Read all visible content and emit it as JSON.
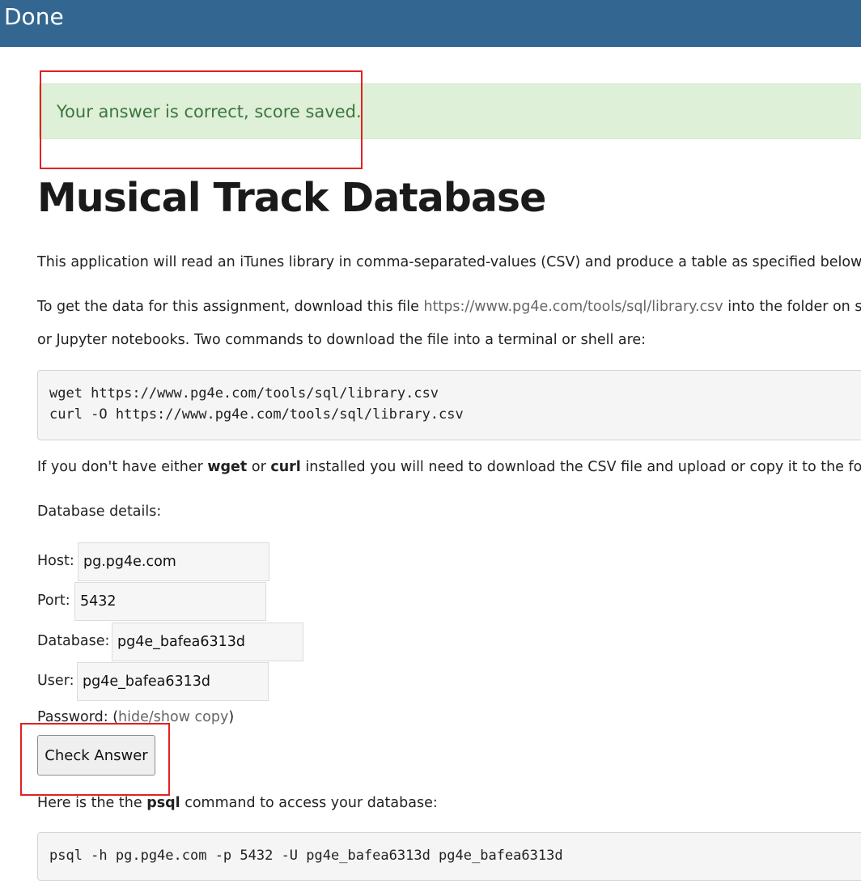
{
  "header": {
    "done_label": "Done"
  },
  "alert": {
    "message": "Your answer is correct, score saved."
  },
  "page": {
    "title": "Musical Track Database",
    "intro": "This application will read an iTunes library in comma-separated-values (CSV) and produce a table as specified below.",
    "download_prefix": "To get the data for this assignment, download this file ",
    "download_link": "https://www.pg4e.com/tools/sql/library.csv",
    "download_suffix": " into the folder on sys",
    "download_line2": "or Jupyter notebooks. Two commands to download the file into a terminal or shell are:",
    "code_lines": [
      "wget https://www.pg4e.com/tools/sql/library.csv",
      "curl -O https://www.pg4e.com/tools/sql/library.csv"
    ],
    "no_tools_prefix": "If you don't have either ",
    "no_tools_wget": "wget",
    "no_tools_or": " or ",
    "no_tools_curl": "curl",
    "no_tools_suffix": " installed you will need to download the CSV file and upload or copy it to the folder",
    "db_details_label": "Database details:"
  },
  "db": {
    "host_label": "Host:",
    "host_value": "pg.pg4e.com",
    "port_label": "Port:",
    "port_value": "5432",
    "database_label": "Database:",
    "database_value": "pg4e_bafea6313d",
    "user_label": "User:",
    "user_value": "pg4e_bafea6313d",
    "password_label": "Password:",
    "password_open": "(",
    "password_link": "hide/show copy",
    "password_close": ")"
  },
  "actions": {
    "check_answer_label": "Check Answer"
  },
  "psql": {
    "prefix": "Here is the the ",
    "command_word": "psql",
    "suffix": " command to access your database:",
    "command": "psql -h pg.pg4e.com -p 5432 -U pg4e_bafea6313d pg4e_bafea6313d"
  },
  "colors": {
    "header_bg": "#336791",
    "alert_bg": "#dff0d8",
    "alert_text": "#3c763d",
    "annotation_red": "#e32020"
  }
}
